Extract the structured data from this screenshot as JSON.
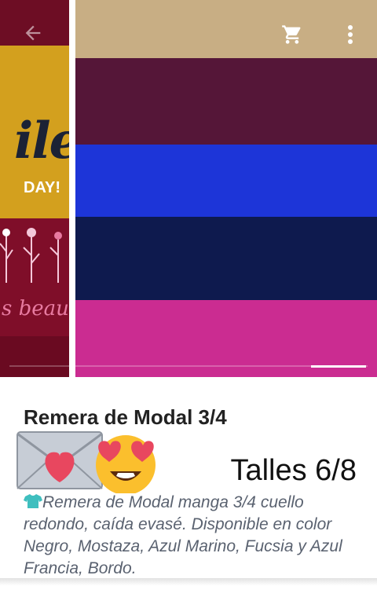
{
  "navigation": {
    "back_icon": "arrow-left-icon",
    "cart_icon": "shopping-cart-icon",
    "more_icon": "more-vertical-icon"
  },
  "gallery": {
    "colors": {
      "beige": "#c8ae84",
      "bordo": "#551638",
      "azul_francia": "#1d35d8",
      "azul_marino": "#0e1a4e",
      "fucsia": "#cb2c91"
    }
  },
  "product": {
    "title": "Remera de Modal 3/4",
    "emojis": [
      "love-letter-icon",
      "heart-eyes-icon"
    ],
    "sizes": "Talles 6/8",
    "description_icon": "tshirt-icon",
    "description": "Remera de Modal manga 3/4 cuello redondo, caída evasé. Disponible en color Negro, Mostaza, Azul Marino, Fucsia y  Azul Francia, Bordo."
  }
}
